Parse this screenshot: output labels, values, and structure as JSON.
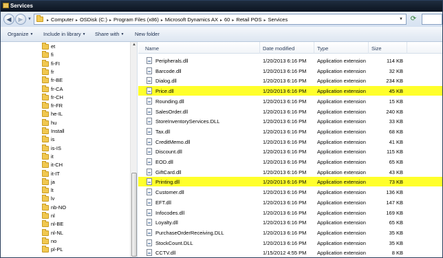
{
  "window": {
    "title": "Services"
  },
  "address": {
    "crumbs": [
      "Computer",
      "OSDisk (C:)",
      "Program Files (x86)",
      "Microsoft Dynamics AX",
      "60",
      "Retail POS",
      "Services"
    ]
  },
  "toolbar": {
    "organize": "Organize",
    "include_in_library": "Include in library",
    "share_with": "Share with",
    "new_folder": "New folder"
  },
  "nav_tree": [
    "et",
    "fi",
    "fi-FI",
    "fr",
    "fr-BE",
    "fr-CA",
    "fr-CH",
    "fr-FR",
    "he-IL",
    "hu",
    "Install",
    "is",
    "is-IS",
    "it",
    "it-CH",
    "it-IT",
    "ja",
    "lt",
    "lv",
    "nb-NO",
    "nl",
    "nl-BE",
    "nl-NL",
    "no",
    "pl-PL"
  ],
  "columns": {
    "name": "Name",
    "date_modified": "Date modified",
    "type": "Type",
    "size": "Size"
  },
  "files": [
    {
      "name": "Peripherals.dll",
      "date": "1/20/2013 6:16 PM",
      "type": "Application extension",
      "size": "114 KB",
      "highlighted": false
    },
    {
      "name": "Barcode.dll",
      "date": "1/20/2013 6:16 PM",
      "type": "Application extension",
      "size": "32 KB",
      "highlighted": false
    },
    {
      "name": "Dialog.dll",
      "date": "1/20/2013 6:16 PM",
      "type": "Application extension",
      "size": "234 KB",
      "highlighted": false
    },
    {
      "name": "Price.dll",
      "date": "1/20/2013 6:16 PM",
      "type": "Application extension",
      "size": "45 KB",
      "highlighted": true
    },
    {
      "name": "Rounding.dll",
      "date": "1/20/2013 6:16 PM",
      "type": "Application extension",
      "size": "15 KB",
      "highlighted": false
    },
    {
      "name": "SalesOrder.dll",
      "date": "1/20/2013 6:16 PM",
      "type": "Application extension",
      "size": "240 KB",
      "highlighted": false
    },
    {
      "name": "StoreInventoryServices.DLL",
      "date": "1/20/2013 6:16 PM",
      "type": "Application extension",
      "size": "33 KB",
      "highlighted": false
    },
    {
      "name": "Tax.dll",
      "date": "1/20/2013 6:16 PM",
      "type": "Application extension",
      "size": "68 KB",
      "highlighted": false
    },
    {
      "name": "CreditMemo.dll",
      "date": "1/20/2013 6:16 PM",
      "type": "Application extension",
      "size": "41 KB",
      "highlighted": false
    },
    {
      "name": "Discount.dll",
      "date": "1/20/2013 6:16 PM",
      "type": "Application extension",
      "size": "115 KB",
      "highlighted": false
    },
    {
      "name": "EOD.dll",
      "date": "1/20/2013 6:16 PM",
      "type": "Application extension",
      "size": "65 KB",
      "highlighted": false
    },
    {
      "name": "GiftCard.dll",
      "date": "1/20/2013 6:16 PM",
      "type": "Application extension",
      "size": "43 KB",
      "highlighted": false
    },
    {
      "name": "Printing.dll",
      "date": "1/20/2013 6:16 PM",
      "type": "Application extension",
      "size": "73 KB",
      "highlighted": true
    },
    {
      "name": "Customer.dll",
      "date": "1/20/2013 6:16 PM",
      "type": "Application extension",
      "size": "136 KB",
      "highlighted": false
    },
    {
      "name": "EFT.dll",
      "date": "1/20/2013 6:16 PM",
      "type": "Application extension",
      "size": "147 KB",
      "highlighted": false
    },
    {
      "name": "Infocodes.dll",
      "date": "1/20/2013 6:16 PM",
      "type": "Application extension",
      "size": "169 KB",
      "highlighted": false
    },
    {
      "name": "Loyalty.dll",
      "date": "1/20/2013 6:16 PM",
      "type": "Application extension",
      "size": "65 KB",
      "highlighted": false
    },
    {
      "name": "PurchaseOrderReceiving.DLL",
      "date": "1/20/2013 6:16 PM",
      "type": "Application extension",
      "size": "35 KB",
      "highlighted": false
    },
    {
      "name": "StockCount.DLL",
      "date": "1/20/2013 6:16 PM",
      "type": "Application extension",
      "size": "35 KB",
      "highlighted": false
    },
    {
      "name": "CCTV.dll",
      "date": "1/15/2012 4:55 PM",
      "type": "Application extension",
      "size": "8 KB",
      "highlighted": false
    }
  ],
  "colors": {
    "highlight": "#ffff2b",
    "title_bar": "#1f2d3f",
    "folder": "#f1c850"
  }
}
